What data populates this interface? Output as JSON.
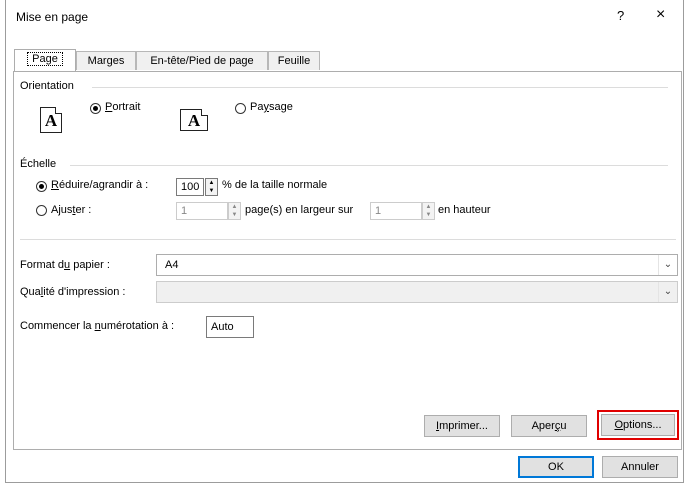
{
  "window": {
    "title": "Mise en page",
    "help": "?",
    "close": "×"
  },
  "tabs": [
    {
      "label": "Page"
    },
    {
      "label": "Marges"
    },
    {
      "label": "En-tête/Pied de page"
    },
    {
      "label": "Feuille"
    }
  ],
  "orientation": {
    "label": "Orientation",
    "portrait_pre": "",
    "portrait_u": "P",
    "portrait_post": "ortrait",
    "paysage_pre": "Pa",
    "paysage_u": "y",
    "paysage_post": "sage",
    "icon_letter": "A"
  },
  "scale": {
    "label": "Échelle",
    "reduce_u": "R",
    "reduce_post": "éduire/agrandir à :",
    "reduce_value": "100",
    "reduce_suffix": "% de la taille normale",
    "fit_pre": "Ajus",
    "fit_u": "t",
    "fit_post": "er :",
    "fit_width_value": "1",
    "fit_width_suffix": "page(s) en largeur sur",
    "fit_height_value": "1",
    "fit_height_suffix": "en hauteur"
  },
  "paper": {
    "label_pre": "Format d",
    "label_u": "u",
    "label_post": " papier :",
    "value": "A4"
  },
  "quality": {
    "label_pre": "Qua",
    "label_u": "l",
    "label_post": "ité d'impression :",
    "value": ""
  },
  "numbering": {
    "label_pre": "Commencer la ",
    "label_u": "n",
    "label_post": "umérotation à :",
    "value": "Auto"
  },
  "buttons": {
    "print_u": "I",
    "print_post": "mprimer...",
    "preview_pre": "Aper",
    "preview_u": "ç",
    "preview_post": "u",
    "options_u": "O",
    "options_post": "ptions...",
    "ok": "OK",
    "cancel": "Annuler"
  },
  "colors": {
    "highlight": "#e00000",
    "accent": "#0078d7"
  }
}
